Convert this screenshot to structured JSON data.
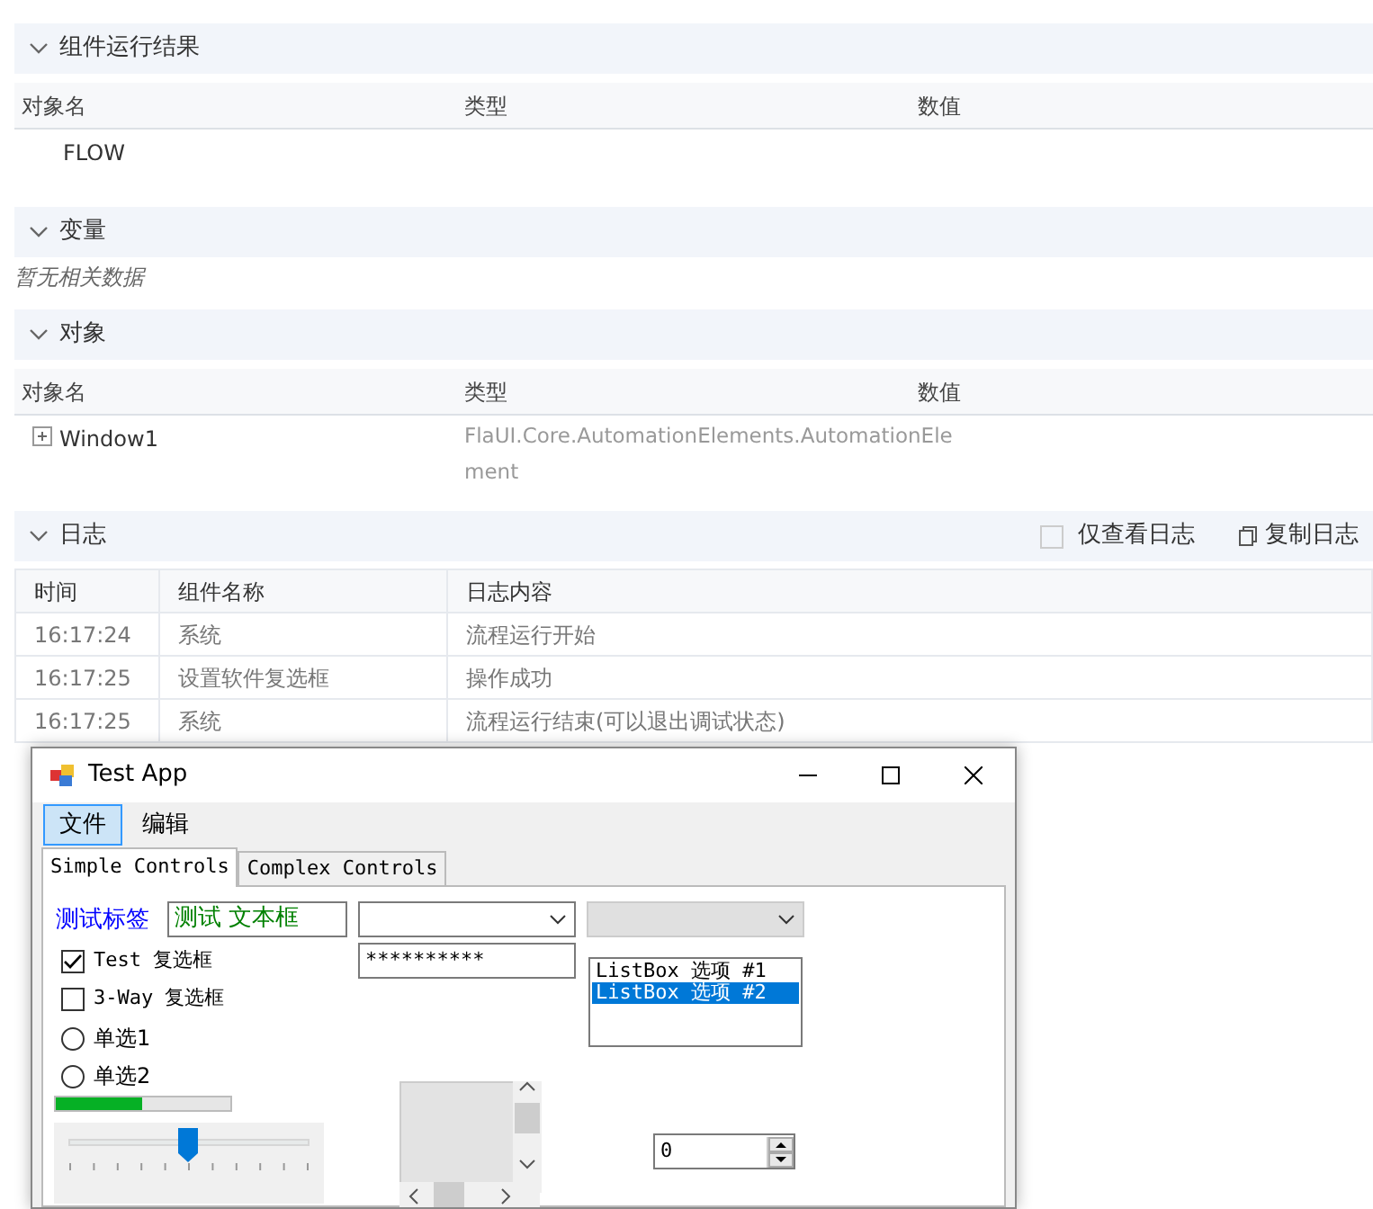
{
  "results": {
    "title": "组件运行结果",
    "columns": [
      "对象名",
      "类型",
      "数值"
    ],
    "rows": [
      {
        "name": "FLOW",
        "type": "",
        "value": ""
      }
    ]
  },
  "variables": {
    "title": "变量",
    "empty_text": "暂无相关数据"
  },
  "objects": {
    "title": "对象",
    "columns": [
      "对象名",
      "类型",
      "数值"
    ],
    "rows": [
      {
        "name": "Window1",
        "expanded": false,
        "type": "FlaUI.Core.AutomationElements.AutomationEle",
        "type_cont": "ment"
      }
    ]
  },
  "log": {
    "title": "日志",
    "only_log": {
      "label": "仅查看日志",
      "checked": false
    },
    "copy_label": "复制日志",
    "columns": [
      "时间",
      "组件名称",
      "日志内容"
    ],
    "rows": [
      {
        "time": "16:17:24",
        "component": "系统",
        "content": "流程运行开始"
      },
      {
        "time": "16:17:25",
        "component": "设置软件复选框",
        "content": "操作成功"
      },
      {
        "time": "16:17:25",
        "component": "系统",
        "content": "流程运行结束(可以退出调试状态)"
      }
    ]
  },
  "app": {
    "title": "Test App",
    "menu": [
      {
        "label": "文件",
        "selected": true
      },
      {
        "label": "编辑",
        "selected": false
      }
    ],
    "tabs": [
      {
        "label": "Simple Controls",
        "selected": true
      },
      {
        "label": "Complex Controls",
        "selected": false
      }
    ],
    "label": "测试标签",
    "textbox": "测试 文本框",
    "password": "**********",
    "checkboxes": [
      {
        "label": "Test 复选框",
        "checked": true
      },
      {
        "label": "3-Way 复选框",
        "checked": false
      }
    ],
    "radios": [
      {
        "label": "单选1",
        "selected": false
      },
      {
        "label": "单选2",
        "selected": false
      }
    ],
    "listbox": [
      {
        "label": "ListBox 选项 #1",
        "selected": false
      },
      {
        "label": "ListBox 选项 #2",
        "selected": true
      }
    ],
    "progress": {
      "level": 0.49
    },
    "slider": {
      "level": 0.49
    },
    "numeric": "0"
  }
}
